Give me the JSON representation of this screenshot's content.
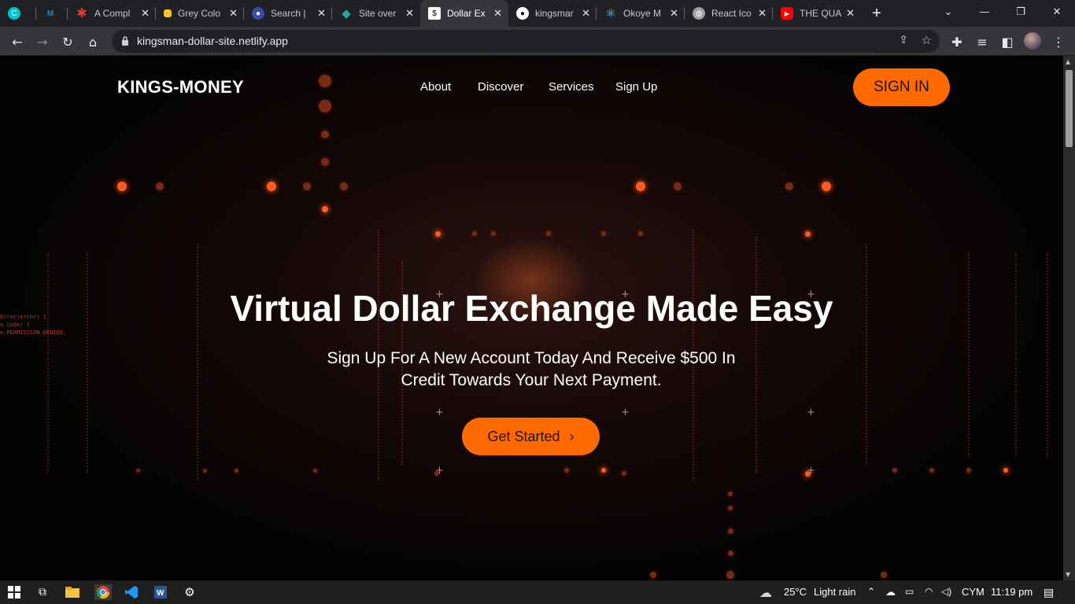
{
  "browser": {
    "tabs": [
      {
        "title": "",
        "icon": "canva-icon",
        "color": "#00c4cc"
      },
      {
        "title": "",
        "icon": "mui-icon",
        "color": "#1e88e5"
      },
      {
        "title": "A Compl",
        "icon": "asterisk-icon",
        "color": "#e53935"
      },
      {
        "title": "Grey Colo",
        "icon": "palette-icon",
        "color": "#fbc02d"
      },
      {
        "title": "Search | ",
        "icon": "search-app-icon",
        "color": "#5c6bc0"
      },
      {
        "title": "Site over",
        "icon": "netlify-icon",
        "color": "#26a69a"
      },
      {
        "title": "Dollar Ex",
        "icon": "site-icon",
        "color": "#ffffff"
      },
      {
        "title": "kingsmar",
        "icon": "github-icon",
        "color": "#ffffff"
      },
      {
        "title": "Okoye M",
        "icon": "react-icon",
        "color": "#61dafb"
      },
      {
        "title": "React Ico",
        "icon": "globe-icon",
        "color": "#9e9e9e"
      },
      {
        "title": "THE QUA",
        "icon": "youtube-icon",
        "color": "#ff0000"
      }
    ],
    "active_tab_index": 6,
    "url": "kingsman-dollar-site.netlify.app"
  },
  "site": {
    "brand": "KINGS-MONEY",
    "nav": [
      "About",
      "Discover",
      "Services",
      "Sign Up"
    ],
    "signin_label": "SIGN IN",
    "hero_title": "Virtual Dollar Exchange Made Easy",
    "hero_subtitle": "Sign Up For A New Account Today And Receive $500 In Credit Towards Your Next Payment.",
    "cta_label": "Get Started",
    "cta_icon": "chevron-right-icon",
    "background_code": [
      "Error(error) {",
      "e.code) {",
      "e.PERMISSION_DENIED:"
    ],
    "accent_color": "#ff6a00"
  },
  "taskbar": {
    "weather_temp": "25°C",
    "weather_text": "Light rain",
    "language": "CYM",
    "time": "11:19 pm"
  }
}
